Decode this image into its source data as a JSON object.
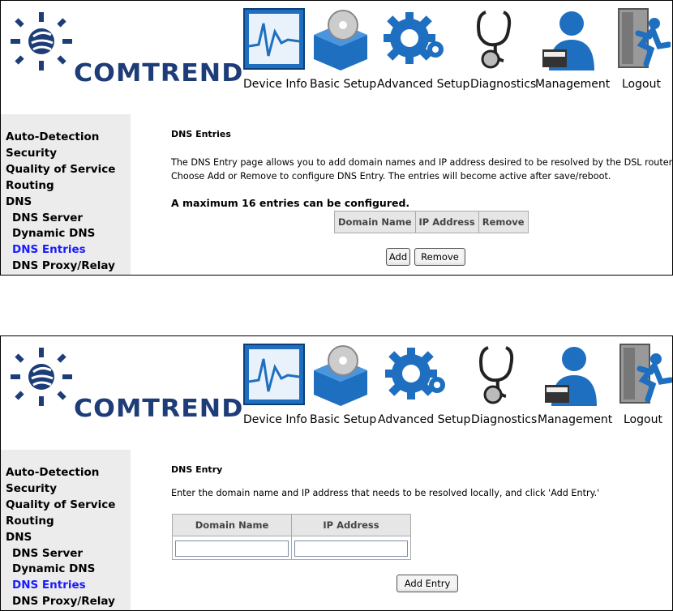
{
  "brand": {
    "name": "COMTREND"
  },
  "nav": [
    {
      "id": "device-info",
      "label": "Device Info"
    },
    {
      "id": "basic-setup",
      "label": "Basic Setup"
    },
    {
      "id": "advanced-setup",
      "label": "Advanced Setup"
    },
    {
      "id": "diagnostics",
      "label": "Diagnostics"
    },
    {
      "id": "management",
      "label": "Management"
    },
    {
      "id": "logout",
      "label": "Logout"
    }
  ],
  "sidebar": {
    "items": [
      "Auto-Detection",
      "Security",
      "Quality of Service",
      "Routing",
      "DNS"
    ],
    "dns_items": [
      "DNS Server",
      "Dynamic DNS",
      "DNS Entries",
      "DNS Proxy/Relay"
    ],
    "active": "DNS Entries"
  },
  "screen1": {
    "title": "DNS Entries",
    "desc1": "The DNS Entry page allows you to add domain names and IP address desired to be resolved by the DSL router.",
    "desc2": "Choose Add or Remove to configure DNS Entry. The entries will become active after save/reboot.",
    "max_note": "A maximum 16 entries can be configured.",
    "columns": [
      "Domain Name",
      "IP Address",
      "Remove"
    ],
    "add_label": "Add",
    "remove_label": "Remove"
  },
  "screen2": {
    "title": "DNS Entry",
    "desc": "Enter the domain name and IP address that needs to be resolved locally, and click 'Add Entry.'",
    "columns": [
      "Domain Name",
      "IP Address"
    ],
    "domain_value": "",
    "ip_value": "",
    "add_entry_label": "Add Entry"
  },
  "colors": {
    "brand": "#1d3c78",
    "active_link": "#1a1aff",
    "sidebar_bg": "#ececec",
    "icon_blue": "#1e6fc0"
  }
}
